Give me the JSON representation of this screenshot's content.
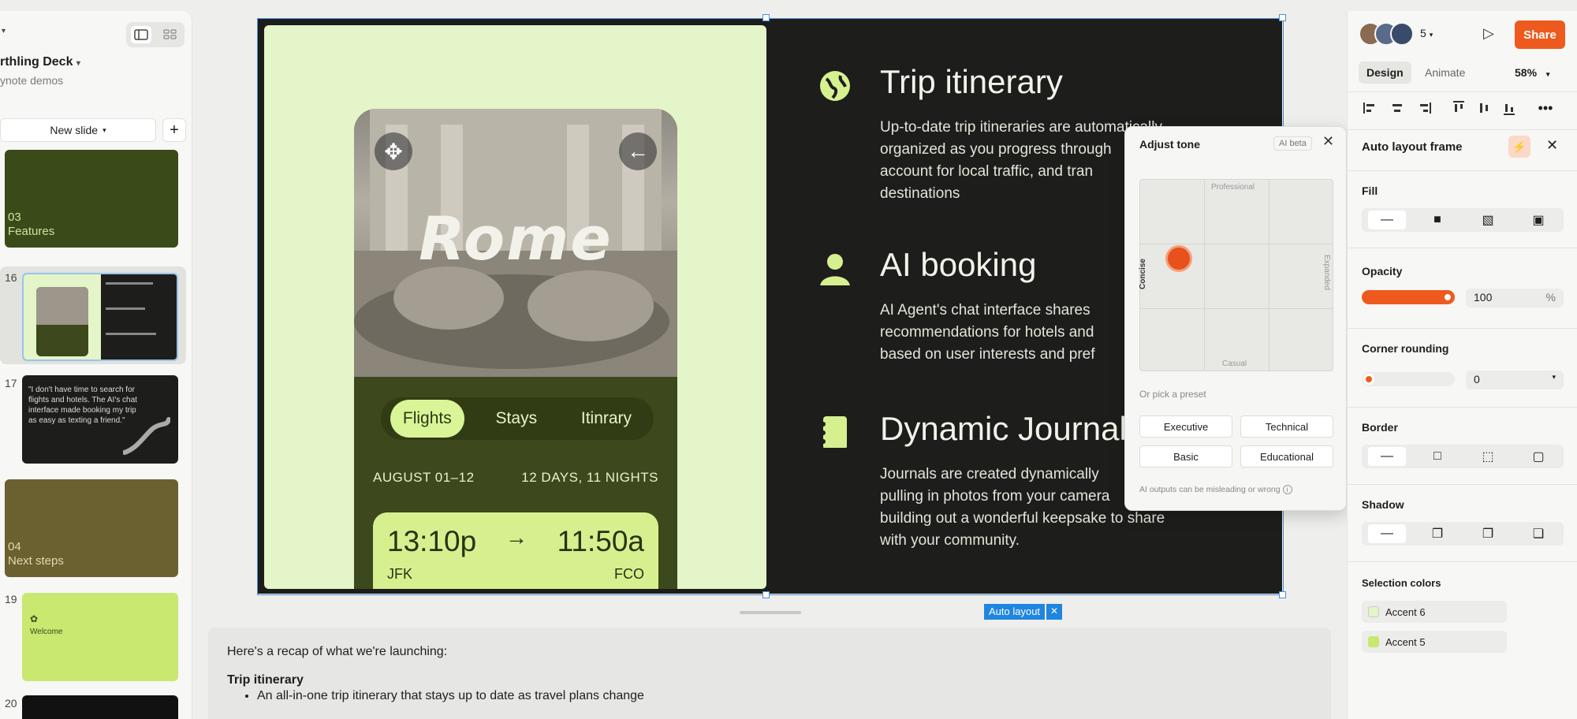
{
  "left_panel": {
    "deck_title": "rthling Deck",
    "deck_subtitle": "ynote demos",
    "new_slide_label": "New slide",
    "slides": [
      {
        "num": "",
        "section_num": "03",
        "section_label": "Features"
      },
      {
        "num": "16"
      },
      {
        "num": "17",
        "quote": "\"I don't have time to search for flights and hotels. The AI's chat interface made booking my trip as easy as texting a friend.\""
      },
      {
        "num": "",
        "section_num": "04",
        "section_label": "Next steps"
      },
      {
        "num": "19",
        "label": "Welcome"
      },
      {
        "num": "20"
      }
    ]
  },
  "slide": {
    "phone": {
      "city": "Rome",
      "tabs": [
        "Flights",
        "Stays",
        "Itinrary"
      ],
      "dates": "AUGUST 01–12",
      "length": "12 DAYS, 11 NIGHTS",
      "depart_time": "13:10p",
      "arrive_time": "11:50a",
      "depart_airport": "JFK",
      "arrive_airport": "FCO"
    },
    "features": [
      {
        "icon": "globe-icon",
        "title": "Trip itinerary",
        "body": "Up-to-date trip itineraries are automatically\norganized as you progress through\naccount for local traffic, and tran\ndestinations"
      },
      {
        "icon": "person-icon",
        "title": "AI booking",
        "body": "AI Agent's chat interface shares\nrecommendations for hotels and\nbased on user interests and pref"
      },
      {
        "icon": "journal-icon",
        "title": "Dynamic Journals",
        "body": "Journals are created dynamically\npulling in photos from your camera\nbuilding out a wonderful keepsake to share\nwith your community."
      }
    ]
  },
  "tone_popup": {
    "title": "Adjust tone",
    "badge": "AI beta",
    "axis_top": "Professional",
    "axis_bottom": "Casual",
    "axis_left": "Concise",
    "axis_right": "Expanded",
    "preset_label": "Or pick a preset",
    "presets": [
      "Executive",
      "Technical",
      "Basic",
      "Educational"
    ],
    "note": "AI outputs can be misleading or wrong"
  },
  "canvas": {
    "autolayout_chip": "Auto layout"
  },
  "notes": {
    "intro": "Here's a recap of what we're launching:",
    "heading": "Trip itinerary",
    "bullet": "An all-in-one trip itinerary that stays up to date as travel plans change"
  },
  "right_panel": {
    "collaborator_count": "5",
    "share_label": "Share",
    "tabs": [
      "Design",
      "Animate"
    ],
    "zoom": "58%",
    "frame_title": "Auto layout frame",
    "fill_label": "Fill",
    "opacity_label": "Opacity",
    "opacity_value": "100",
    "opacity_unit": "%",
    "corner_label": "Corner rounding",
    "corner_value": "0",
    "border_label": "Border",
    "shadow_label": "Shadow",
    "selection_colors_label": "Selection colors",
    "colors": [
      {
        "name": "Accent 6",
        "hex": "#e3f5c9"
      },
      {
        "name": "Accent 5",
        "hex": "#c8e870"
      }
    ]
  },
  "colors": {
    "accent": "#ee5a1d",
    "selection": "#4a90d9",
    "slide_dark": "#1d1d1b",
    "slide_light": "#e3f5c9"
  }
}
